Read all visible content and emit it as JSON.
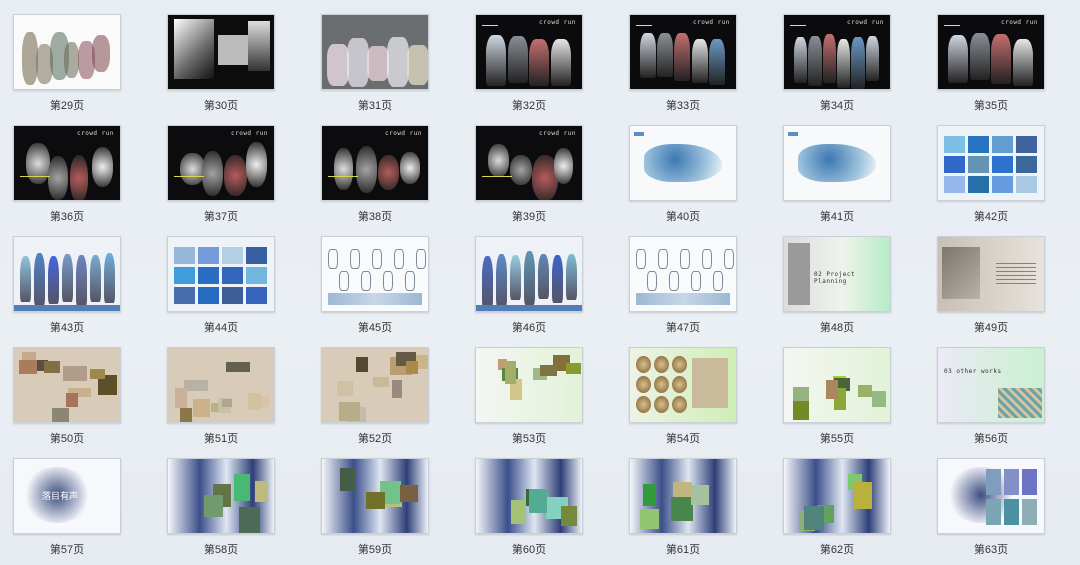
{
  "pages": [
    {
      "label": "第29页",
      "style": "sketch-white"
    },
    {
      "label": "第30页",
      "style": "bw-photo"
    },
    {
      "label": "第31页",
      "style": "gray-collage"
    },
    {
      "label": "第32页",
      "style": "dark-looks"
    },
    {
      "label": "第33页",
      "style": "dark-looks"
    },
    {
      "label": "第34页",
      "style": "dark-looks"
    },
    {
      "label": "第35页",
      "style": "dark-looks"
    },
    {
      "label": "第36页",
      "style": "dark-collage"
    },
    {
      "label": "第37页",
      "style": "dark-collage"
    },
    {
      "label": "第38页",
      "style": "dark-collage"
    },
    {
      "label": "第39页",
      "style": "dark-collage"
    },
    {
      "label": "第40页",
      "style": "blue-white"
    },
    {
      "label": "第41页",
      "style": "blue-white"
    },
    {
      "label": "第42页",
      "style": "blue-grid"
    },
    {
      "label": "第43页",
      "style": "blue-figures"
    },
    {
      "label": "第44页",
      "style": "blue-grid"
    },
    {
      "label": "第45页",
      "style": "sketch-blue"
    },
    {
      "label": "第46页",
      "style": "blue-figures"
    },
    {
      "label": "第47页",
      "style": "sketch-blue"
    },
    {
      "label": "第48页",
      "style": "planning"
    },
    {
      "label": "第49页",
      "style": "beige-text"
    },
    {
      "label": "第50页",
      "style": "beige-collage"
    },
    {
      "label": "第51页",
      "style": "beige-collage"
    },
    {
      "label": "第52页",
      "style": "beige-collage"
    },
    {
      "label": "第53页",
      "style": "green-white"
    },
    {
      "label": "第54页",
      "style": "green-tiles"
    },
    {
      "label": "第55页",
      "style": "green-white"
    },
    {
      "label": "第56页",
      "style": "other-works"
    },
    {
      "label": "第57页",
      "style": "ink-white"
    },
    {
      "label": "第58页",
      "style": "ink-blue"
    },
    {
      "label": "第59页",
      "style": "ink-blue"
    },
    {
      "label": "第60页",
      "style": "ink-blue"
    },
    {
      "label": "第61页",
      "style": "ink-blue"
    },
    {
      "label": "第62页",
      "style": "ink-blue"
    },
    {
      "label": "第63页",
      "style": "ink-white"
    }
  ],
  "slide_text": {
    "crowd_run": "crowd run",
    "looks": "LOOKS",
    "project_planning": "02 Project Planning",
    "other_works": "03 other works",
    "title_57": "落目有声"
  },
  "colors": {
    "background": "#e8edf3",
    "dark_slide": "#0b0b0d",
    "accent_blue": "#4f7fb6",
    "accent_green": "#b8e6a6",
    "beige": "#d8cbb8"
  }
}
